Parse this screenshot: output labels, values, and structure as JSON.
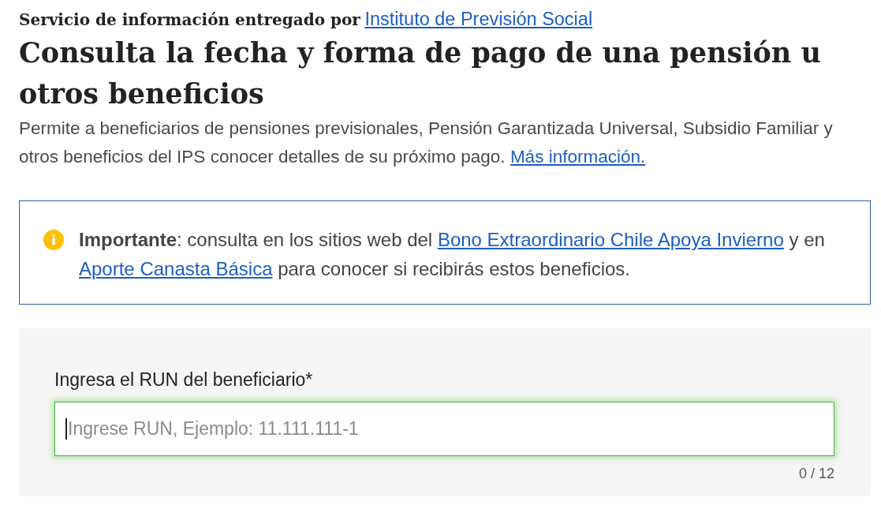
{
  "provider": {
    "label": "Servicio de información entregado por",
    "link": "Instituto de Previsión Social"
  },
  "title": "Consulta la fecha y forma de pago de una pensión u otros beneficios",
  "description": {
    "text": "Permite a beneficiarios de pensiones previsionales, Pensión Garantizada Universal, Subsidio Familiar y otros beneficios del IPS conocer detalles de su próximo pago.",
    "link": "Más información."
  },
  "notice": {
    "parts": [
      {
        "kind": "text",
        "text": "**Importante**: consulta en los sitios web del"
      },
      {
        "kind": "link",
        "text": "Bono Extraordinario Chile Apoya Invierno"
      },
      {
        "kind": "text",
        "text": "y en"
      },
      {
        "kind": "link",
        "text": "Aporte Canasta Básica"
      },
      {
        "kind": "text",
        "text": "para conocer si recibirás estos beneficios."
      }
    ]
  },
  "form": {
    "label": "Ingresa el RUN del beneficiario*",
    "placeholder": "Ingrese RUN, Ejemplo: 11.111.111-1",
    "focused": true,
    "counter": "0 / 12"
  }
}
